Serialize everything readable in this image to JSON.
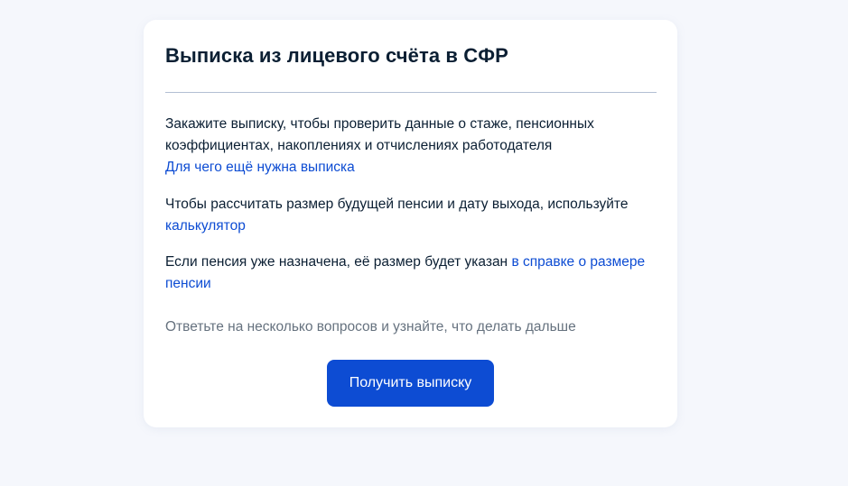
{
  "card": {
    "title": "Выписка из лицевого счёта в СФР",
    "paragraph1": {
      "text_line1": "Закажите выписку, чтобы проверить данные о стаже, пенсионных",
      "text_line2": "коэффициентах, накоплениях и отчислениях работодателя",
      "link": "Для чего ещё нужна выписка"
    },
    "paragraph2": {
      "text": "Чтобы рассчитать размер будущей пенсии и дату выхода, используйте",
      "link": "калькулятор"
    },
    "paragraph3": {
      "text": "Если пенсия уже назначена, её размер будет указан ",
      "link": "в справке о размере пенсии"
    },
    "hint": "Ответьте на несколько вопросов и узнайте, что делать дальше",
    "button_label": "Получить выписку"
  },
  "colors": {
    "page_background": "#f5f7fc",
    "card_background": "#ffffff",
    "text": "#0b1f33",
    "link": "#0d4cd3",
    "hint": "#66727f",
    "button": "#0d4cd3",
    "divider": "#b3bfd3"
  }
}
